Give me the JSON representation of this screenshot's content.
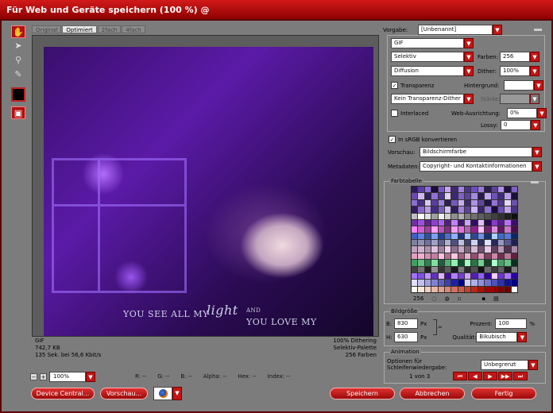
{
  "window": {
    "title": "Für Web und Geräte speichern (100 %) @"
  },
  "tools": [
    "hand-tool",
    "slice-select-tool",
    "zoom-tool",
    "eyedropper-tool",
    "eyedropper-color",
    "toggle-slices"
  ],
  "view_tabs": [
    "Original",
    "Optimiert",
    "2fach",
    "4fach"
  ],
  "preview": {
    "caption_1": "YOU SEE ALL MY",
    "caption_2": "light",
    "caption_3": "AND",
    "caption_4": "YOU LOVE MY"
  },
  "info": {
    "format": "GIF",
    "size": "742,7 KB",
    "time": "135 Sek. bei 56,6 Kbit/s",
    "dithering": "100% Dithering",
    "palette": "Selektiv-Palette",
    "colors": "256 Farben"
  },
  "status": {
    "zoom_minus": "−",
    "zoom_plus": "+",
    "zoom": "100%",
    "r": "R: --",
    "g": "G: --",
    "b": "B: --",
    "alpha": "Alpha: --",
    "hex": "Hex: --",
    "index": "Index: --"
  },
  "settings": {
    "preset_label": "Vorgabe:",
    "preset": "[Unbenannt]",
    "format": "GIF",
    "reduction": "Selektiv",
    "colors_label": "Farben:",
    "colors": "256",
    "dither_algo": "Diffusion",
    "dither_label": "Dither:",
    "dither": "100%",
    "transparency_label": "Transparenz",
    "transparency_checked": true,
    "matte_label": "Hintergrund:",
    "transparency_dither": "Kein Transparenz-Dither",
    "amount_label": "Stärke:",
    "interlaced_label": "Interlaced",
    "interlaced_checked": false,
    "web_snap_label": "Web-Ausrichtung:",
    "web_snap": "0%",
    "lossy_label": "Lossy:",
    "lossy": "0",
    "srgb_label": "In sRGB konvertieren",
    "srgb_checked": true,
    "preview_label": "Vorschau:",
    "preview_value": "Bildschirmfarbe",
    "metadata_label": "Metadaten:",
    "metadata_value": "Copyright- und Kontaktinformationen"
  },
  "color_table": {
    "title": "Farbtabelle",
    "count": "256",
    "swatches": [
      "#2b1a5a",
      "#5b3ba8",
      "#8c6ee0",
      "#1a0e33",
      "#7a55c8",
      "#c8a0f0",
      "#3d2a70",
      "#a080e0",
      "#4a3585",
      "#6b4fc0",
      "#9a7ad8",
      "#2a1d4d",
      "#5a4590",
      "#b090e8",
      "#1e1240",
      "#8060c0",
      "#6a4ab0",
      "#d0b8f0",
      "#2f2060",
      "#9070d0",
      "#4b3690",
      "#e0d0f8",
      "#3a2870",
      "#7e62c8",
      "#5c42a0",
      "#a48ae0",
      "#271a50",
      "#c0a8ec",
      "#6e52b8",
      "#3e2c78",
      "#b89ee8",
      "#1c1038",
      "#8a6ed0",
      "#45307e",
      "#d8c8f4",
      "#5a3ea0",
      "#9e84dc",
      "#2c1e58",
      "#745ab8",
      "#c8b0ee",
      "#3c2a6e",
      "#ae92e4",
      "#60469e",
      "#201448",
      "#9474d4",
      "#4e3a88",
      "#e4d8f8",
      "#6c50ac",
      "#301c5c",
      "#8a66cc",
      "#b89ce6",
      "#422e80",
      "#7a5ec2",
      "#d2bef2",
      "#2e1e5a",
      "#a284de",
      "#5e4298",
      "#cab4f0",
      "#3a266c",
      "#8e72d2",
      "#1a0c34",
      "#6a4eb6",
      "#bea2ea",
      "#4a3284",
      "#c0c0c0",
      "#ffffff",
      "#e0e0e0",
      "#a0a0a0",
      "#f0f0f0",
      "#d0d0d0",
      "#909090",
      "#b0b0b0",
      "#808080",
      "#707070",
      "#606060",
      "#505050",
      "#404040",
      "#303030",
      "#202020",
      "#101010",
      "#7030a0",
      "#a050e0",
      "#602090",
      "#9040d0",
      "#b060f0",
      "#502080",
      "#c080ff",
      "#401870",
      "#d0a0ff",
      "#301060",
      "#e0c0ff",
      "#2a0a50",
      "#8a3ac8",
      "#5a1c8c",
      "#b870f4",
      "#3a1068",
      "#ff80ff",
      "#d060d0",
      "#a040a0",
      "#ffa0ff",
      "#c050c0",
      "#803080",
      "#f0a0f0",
      "#e070e0",
      "#b060b0",
      "#902090",
      "#ffc0ff",
      "#702070",
      "#d890d8",
      "#601860",
      "#c878c8",
      "#481048",
      "#4060c0",
      "#6080e0",
      "#3050a0",
      "#80a0f0",
      "#2040a0",
      "#5070d0",
      "#90b0f8",
      "#203080",
      "#a0c0ff",
      "#304890",
      "#7090e8",
      "#183070",
      "#b0d0ff",
      "#406cc8",
      "#5878d8",
      "#102860",
      "#8080a0",
      "#9090b0",
      "#7070a0",
      "#a0a0c0",
      "#606090",
      "#b0b0d0",
      "#505080",
      "#c0c0e0",
      "#404070",
      "#d0d0f0",
      "#303060",
      "#e0e0ff",
      "#28285a",
      "#9898c0",
      "#585890",
      "#202050",
      "#c0a0c0",
      "#d0b0d0",
      "#b090b0",
      "#e0c0e0",
      "#a080a0",
      "#f0d0f0",
      "#907090",
      "#c8a8c8",
      "#806080",
      "#d8b8d8",
      "#705070",
      "#e8c8e8",
      "#604060",
      "#b898b8",
      "#503050",
      "#a888a8",
      "#e0a0c0",
      "#f0b0d0",
      "#d090b0",
      "#c080a0",
      "#ffc0e0",
      "#b07090",
      "#f8c8e0",
      "#a06080",
      "#e8b0cc",
      "#905070",
      "#d898b8",
      "#804060",
      "#c888a8",
      "#703050",
      "#b87898",
      "#602040",
      "#40a060",
      "#60c080",
      "#308050",
      "#80e0a0",
      "#206040",
      "#50b070",
      "#90f0b0",
      "#105030",
      "#a0ffc0",
      "#307048",
      "#70d090",
      "#184028",
      "#b0ffd0",
      "#48a068",
      "#68c088",
      "#0c3020",
      "#404040",
      "#707070",
      "#202020",
      "#909090",
      "#353535",
      "#5a5a5a",
      "#181818",
      "#7a7a7a",
      "#2a2a2a",
      "#505050",
      "#101010",
      "#6a6a6a",
      "#3a3a3a",
      "#606060",
      "#1a1a1a",
      "#808080",
      "#a070ff",
      "#8050e0",
      "#c090ff",
      "#6030c0",
      "#e0b0ff",
      "#4010a0",
      "#b080ff",
      "#7040d0",
      "#d0a0ff",
      "#5020b0",
      "#9060f0",
      "#3000a0",
      "#f0d0ff",
      "#6838c8",
      "#a878ff",
      "#2800a0",
      "#e0e0ff",
      "#c0c0f0",
      "#a0a0e0",
      "#8080d0",
      "#6060c0",
      "#4040b0",
      "#2020a0",
      "#000090",
      "#d0d0ff",
      "#b0b0e8",
      "#9090d8",
      "#7070c8",
      "#5050b8",
      "#3030a8",
      "#101098",
      "#000080",
      "#fffaf0",
      "#f8e8d8",
      "#f0d0c0",
      "#e8b8a8",
      "#e0a090",
      "#d88878",
      "#d07060",
      "#c85848",
      "#c04030",
      "#b82818",
      "#b01000",
      "#a00000",
      "#900000",
      "#800000",
      "#700000",
      "#ffffff"
    ]
  },
  "image_size": {
    "title": "Bildgröße",
    "w_label": "B:",
    "w": "830",
    "h_label": "H:",
    "h": "630",
    "unit": "Px",
    "percent_label": "Prozent:",
    "percent": "100",
    "percent_unit": "%",
    "quality_label": "Qualität:",
    "quality": "Bikubisch"
  },
  "animation": {
    "title": "Animation",
    "loop_label": "Optionen für Schleifenwiedergabe:",
    "loop": "Unbegrenzt",
    "frame": "1 von 3"
  },
  "buttons": {
    "device_central": "Device Central...",
    "preview": "Vorschau...",
    "save": "Speichern",
    "cancel": "Abbrechen",
    "done": "Fertig"
  },
  "colors": {
    "accent": "#c21515",
    "title_bg": "#a80808",
    "panel_bg": "#858585"
  }
}
